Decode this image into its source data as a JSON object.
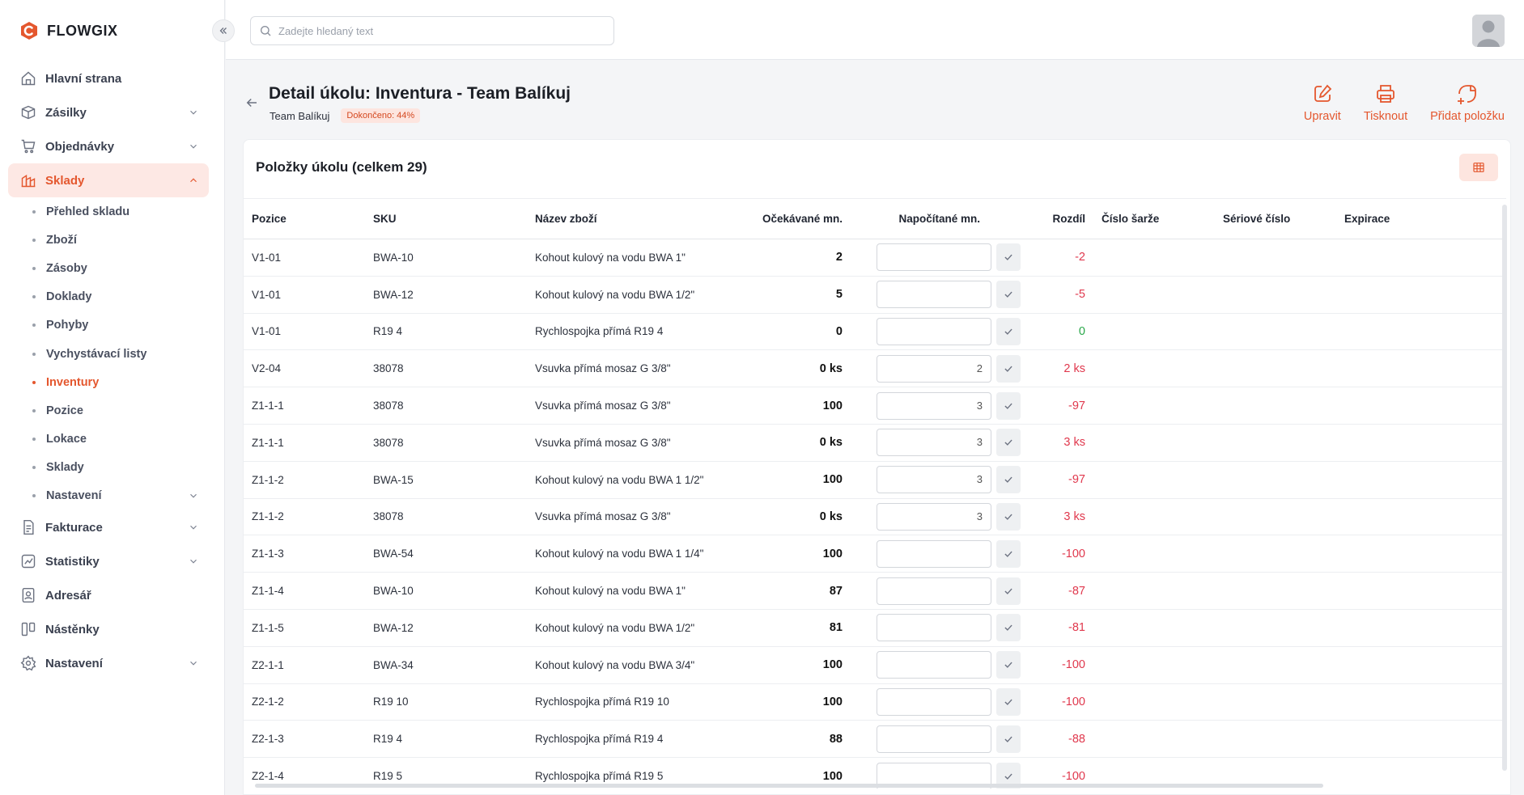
{
  "app": {
    "name": "FLOWGIX"
  },
  "search": {
    "placeholder": "Zadejte hledaný text"
  },
  "sidebar": {
    "items": [
      {
        "label": "Hlavní strana",
        "icon": "home-icon"
      },
      {
        "label": "Zásilky",
        "icon": "package-icon"
      },
      {
        "label": "Objednávky",
        "icon": "cart-icon"
      },
      {
        "label": "Sklady",
        "icon": "warehouse-icon"
      },
      {
        "label": "Fakturace",
        "icon": "invoice-icon"
      },
      {
        "label": "Statistiky",
        "icon": "statistics-icon"
      },
      {
        "label": "Adresář",
        "icon": "contacts-icon"
      },
      {
        "label": "Nástěnky",
        "icon": "boards-icon"
      },
      {
        "label": "Nastavení",
        "icon": "gear-icon"
      }
    ],
    "sklady_sub": [
      "Přehled skladu",
      "Zboží",
      "Zásoby",
      "Doklady",
      "Pohyby",
      "Vychystávací listy",
      "Inventury",
      "Pozice",
      "Lokace",
      "Sklady",
      "Nastavení"
    ]
  },
  "header": {
    "title": "Detail úkolu: Inventura - Team Balíkuj",
    "team": "Team Balíkuj",
    "status": "Dokončeno: 44%"
  },
  "actions": {
    "edit": "Upravit",
    "print": "Tisknout",
    "add": "Přidat položku"
  },
  "card": {
    "title": "Položky úkolu (celkem 29)"
  },
  "table": {
    "headers": {
      "pos": "Pozice",
      "sku": "SKU",
      "name": "Název zboží",
      "expected": "Očekávané mn.",
      "counted": "Napočítané mn.",
      "diff": "Rozdíl",
      "batch": "Číslo šarže",
      "serial": "Sériové číslo",
      "expiry": "Expirace"
    },
    "rows": [
      {
        "pos": "V1-01",
        "sku": "BWA-10",
        "name": "Kohout kulový na vodu BWA 1\"",
        "expected": "2",
        "counted": "",
        "diff": "-2"
      },
      {
        "pos": "V1-01",
        "sku": "BWA-12",
        "name": "Kohout kulový na vodu BWA 1/2\"",
        "expected": "5",
        "counted": "",
        "diff": "-5"
      },
      {
        "pos": "V1-01",
        "sku": "R19 4",
        "name": "Rychlospojka přímá R19 4",
        "expected": "0",
        "counted": "",
        "diff": "0"
      },
      {
        "pos": "V2-04",
        "sku": "38078",
        "name": "Vsuvka přímá mosaz G 3/8\"",
        "expected": "0 ks",
        "counted": "2",
        "diff": "2 ks"
      },
      {
        "pos": "Z1-1-1",
        "sku": "38078",
        "name": "Vsuvka přímá mosaz G 3/8\"",
        "expected": "100",
        "counted": "3",
        "diff": "-97"
      },
      {
        "pos": "Z1-1-1",
        "sku": "38078",
        "name": "Vsuvka přímá mosaz G 3/8\"",
        "expected": "0 ks",
        "counted": "3",
        "diff": "3 ks"
      },
      {
        "pos": "Z1-1-2",
        "sku": "BWA-15",
        "name": "Kohout kulový na vodu BWA 1 1/2\"",
        "expected": "100",
        "counted": "3",
        "diff": "-97"
      },
      {
        "pos": "Z1-1-2",
        "sku": "38078",
        "name": "Vsuvka přímá mosaz G 3/8\"",
        "expected": "0 ks",
        "counted": "3",
        "diff": "3 ks"
      },
      {
        "pos": "Z1-1-3",
        "sku": "BWA-54",
        "name": "Kohout kulový na vodu BWA 1 1/4\"",
        "expected": "100",
        "counted": "",
        "diff": "-100"
      },
      {
        "pos": "Z1-1-4",
        "sku": "BWA-10",
        "name": "Kohout kulový na vodu BWA 1\"",
        "expected": "87",
        "counted": "",
        "diff": "-87"
      },
      {
        "pos": "Z1-1-5",
        "sku": "BWA-12",
        "name": "Kohout kulový na vodu BWA 1/2\"",
        "expected": "81",
        "counted": "",
        "diff": "-81"
      },
      {
        "pos": "Z2-1-1",
        "sku": "BWA-34",
        "name": "Kohout kulový na vodu BWA 3/4\"",
        "expected": "100",
        "counted": "",
        "diff": "-100"
      },
      {
        "pos": "Z2-1-2",
        "sku": "R19 10",
        "name": "Rychlospojka přímá R19 10",
        "expected": "100",
        "counted": "",
        "diff": "-100"
      },
      {
        "pos": "Z2-1-3",
        "sku": "R19 4",
        "name": "Rychlospojka přímá R19 4",
        "expected": "88",
        "counted": "",
        "diff": "-88"
      },
      {
        "pos": "Z2-1-4",
        "sku": "R19 5",
        "name": "Rychlospojka přímá R19 5",
        "expected": "100",
        "counted": "",
        "diff": "-100"
      }
    ]
  },
  "colors": {
    "accent": "#e4572e",
    "negative": "#e0384d",
    "positive": "#29a84a"
  }
}
